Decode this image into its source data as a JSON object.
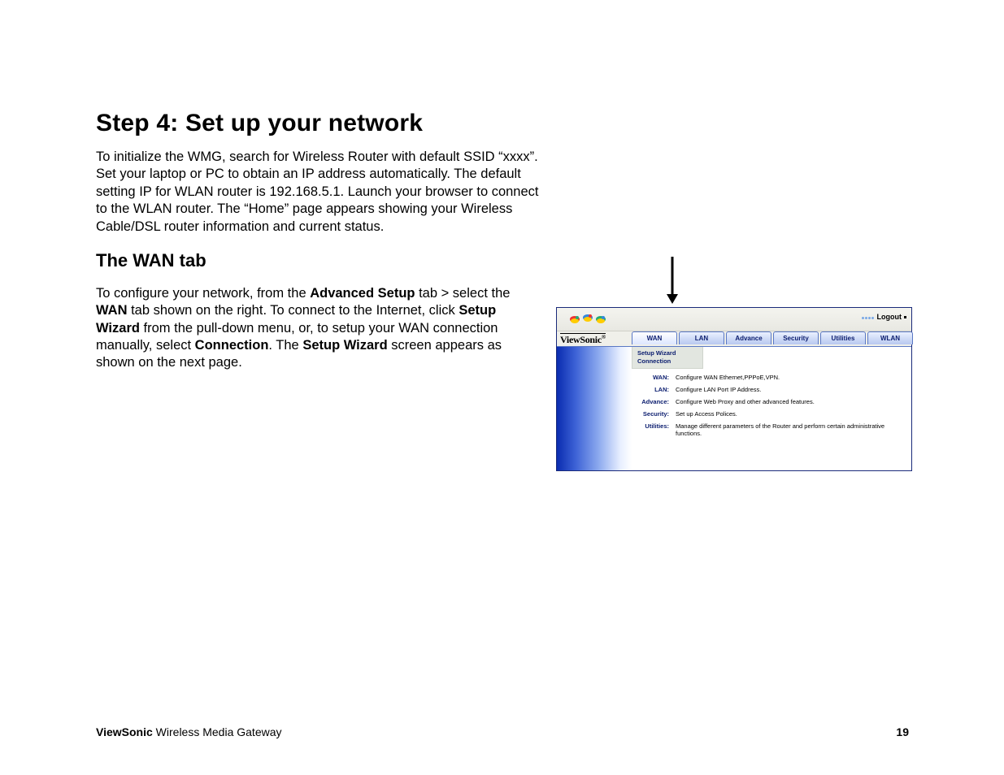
{
  "page": {
    "step_title": "Step 4:  Set up your network",
    "intro": "To initialize the WMG, search for Wireless Router with default SSID “xxxx”.  Set your laptop or PC to obtain an IP address automatically.  The default setting IP for WLAN router is 192.168.5.1. Launch your browser to connect to the WLAN router. The “Home” page appears showing your Wireless Cable/DSL router information and current status.",
    "subhead": "The WAN tab",
    "body_parts": {
      "p1": "To configure your network, from the ",
      "b1": "Advanced Setup",
      "p2": " tab > select the ",
      "b2": "WAN",
      "p3": " tab shown on the right. To connect to the Internet, click ",
      "b3": "Setup Wizard",
      "p4": " from the pull-down menu, or, to setup your WAN connection manually, select ",
      "b4": "Connection",
      "p5": ". The ",
      "b5": "Setup Wizard",
      "p6": " screen appears as shown on the next page."
    }
  },
  "router_ui": {
    "brand": "ViewSonic",
    "brand_reg": "®",
    "logout": "Logout",
    "tabs": [
      "WAN",
      "LAN",
      "Advance",
      "Security",
      "Utilities",
      "WLAN"
    ],
    "active_tab_index": 0,
    "submenu": {
      "line1": "Setup Wizard",
      "line2": "Connection"
    },
    "items": [
      {
        "label": "WAN:",
        "desc": "Configure WAN Ethernet,PPPoE,VPN."
      },
      {
        "label": "LAN:",
        "desc": "Configure LAN Port IP Address."
      },
      {
        "label": "Advance:",
        "desc": "Configure Web Proxy and other advanced features."
      },
      {
        "label": "Security:",
        "desc": "Set up Access Polices."
      },
      {
        "label": "Utilities:",
        "desc": "Manage different parameters of the Router and perform certain administrative functions."
      }
    ]
  },
  "footer": {
    "brand": "ViewSonic",
    "product": " Wireless Media Gateway",
    "page_number": "19"
  }
}
